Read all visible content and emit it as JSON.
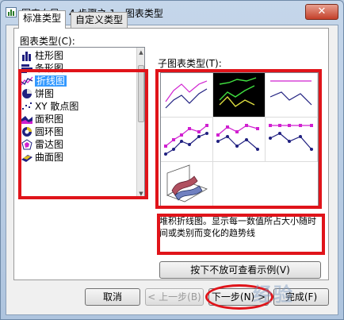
{
  "window": {
    "title": "图表向导 - 4 步骤之 1 - 图表类型",
    "close_glyph": "✕"
  },
  "tabs": [
    {
      "label": "标准类型",
      "active": true
    },
    {
      "label": "自定义类型",
      "active": false
    }
  ],
  "chart_type_list": {
    "label": "图表类型(C):",
    "items": [
      {
        "label": "柱形图",
        "icon": "column-chart-icon"
      },
      {
        "label": "条形图",
        "icon": "bar-chart-icon"
      },
      {
        "label": "折线图",
        "icon": "line-chart-icon",
        "selected": true
      },
      {
        "label": "饼图",
        "icon": "pie-chart-icon"
      },
      {
        "label": "XY 散点图",
        "icon": "scatter-chart-icon"
      },
      {
        "label": "面积图",
        "icon": "area-chart-icon"
      },
      {
        "label": "圆环图",
        "icon": "doughnut-chart-icon"
      },
      {
        "label": "雷达图",
        "icon": "radar-chart-icon"
      },
      {
        "label": "曲面图",
        "icon": "surface-chart-icon"
      }
    ]
  },
  "subtype": {
    "label": "子图表类型(T):",
    "selected_index": 1
  },
  "description": "堆积折线图。显示每一数值所占大小随时间或类别而变化的趋势线",
  "buttons": {
    "preview": "按下不放可查看示例(V)",
    "cancel": "取消",
    "back": "< 上一步(B)",
    "next": "下一步(N) >",
    "finish": "完成(F)"
  },
  "watermark": "经验",
  "colors": {
    "annotation_red": "#e0141a",
    "selection_blue": "#3399ff",
    "subtype_line_magenta": "#d020d0",
    "subtype_line_navy": "#202080",
    "subtype_line_green": "#40e040"
  }
}
